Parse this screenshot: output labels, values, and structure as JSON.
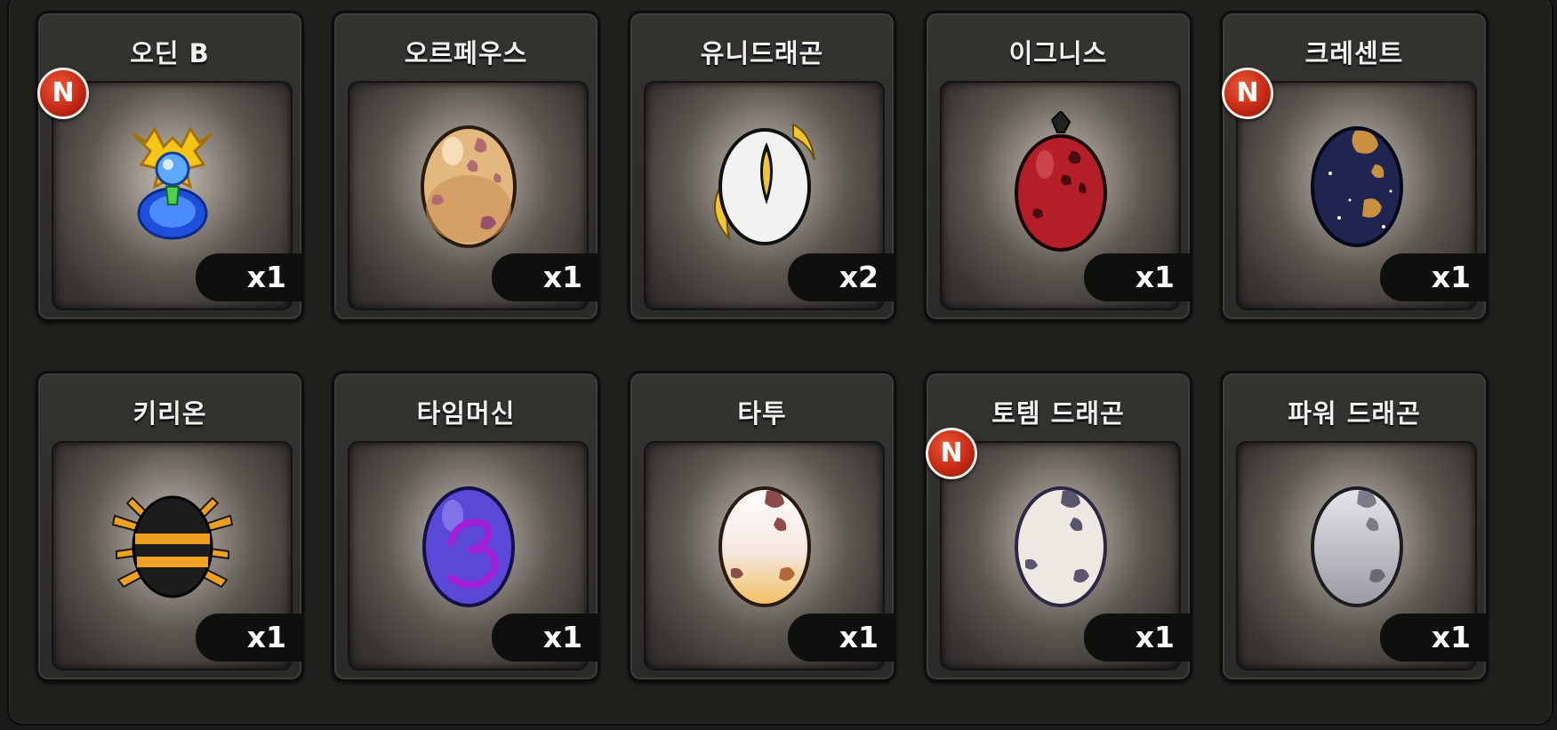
{
  "pets": [
    {
      "name": "오딘 B",
      "qty": "x1",
      "new": true,
      "new_label": "N",
      "icon": "odin-emblem-icon"
    },
    {
      "name": "오르페우스",
      "qty": "x1",
      "new": false,
      "icon": "orpheus-egg-icon"
    },
    {
      "name": "유니드래곤",
      "qty": "x2",
      "new": false,
      "icon": "unidragon-egg-icon"
    },
    {
      "name": "이그니스",
      "qty": "x1",
      "new": false,
      "icon": "ignis-egg-icon"
    },
    {
      "name": "크레센트",
      "qty": "x1",
      "new": true,
      "new_label": "N",
      "icon": "crescent-egg-icon"
    },
    {
      "name": "키리온",
      "qty": "x1",
      "new": false,
      "icon": "kirion-egg-icon"
    },
    {
      "name": "타임머신",
      "qty": "x1",
      "new": false,
      "icon": "timemachine-egg-icon"
    },
    {
      "name": "타투",
      "qty": "x1",
      "new": false,
      "icon": "tattoo-egg-icon"
    },
    {
      "name": "토템 드래곤",
      "qty": "x1",
      "new": true,
      "new_label": "N",
      "icon": "totem-dragon-egg-icon"
    },
    {
      "name": "파워 드래곤",
      "qty": "x1",
      "new": false,
      "icon": "power-dragon-egg-icon"
    }
  ],
  "colors": {
    "panel_bg": "#201f1c",
    "badge_red": "#c62a14",
    "qty_bg": "#0f0f0e"
  }
}
